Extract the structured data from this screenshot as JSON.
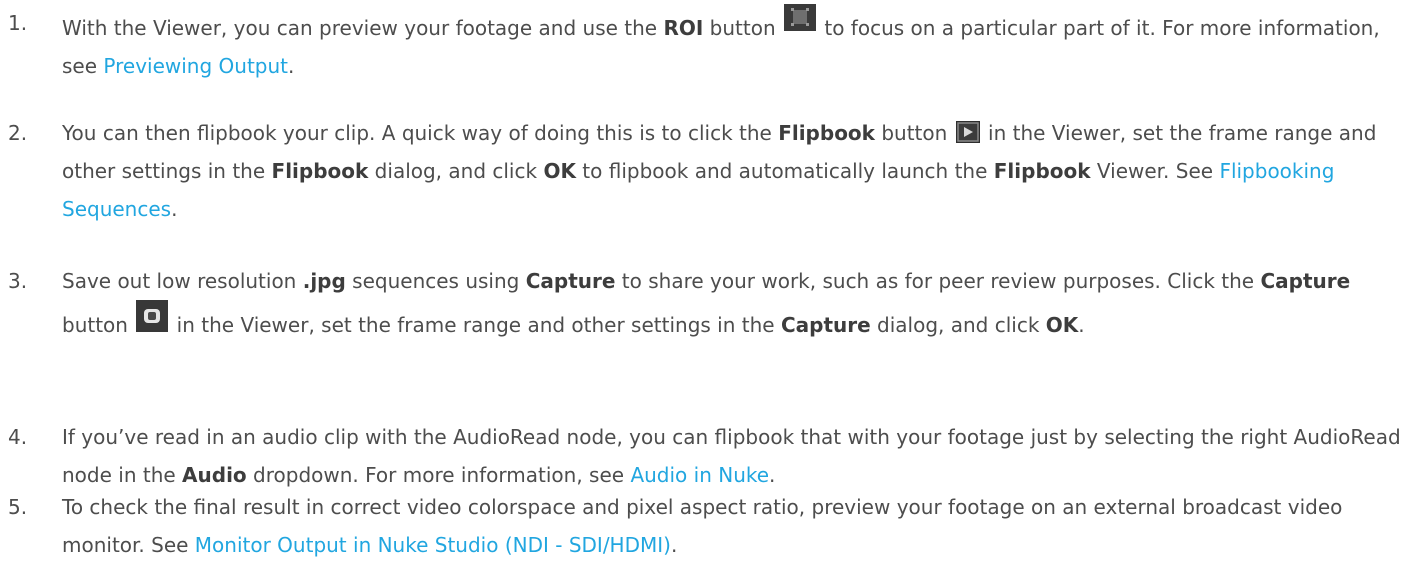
{
  "steps": [
    {
      "number": "1.",
      "t1": "With the Viewer, you can preview your footage and use the ",
      "b1": "ROI",
      "t2": " button ",
      "t3": " to focus on a particular part of it. For more information, see ",
      "link": "Previewing Output",
      "t4": "."
    },
    {
      "number": "2.",
      "t1": "You can then flipbook your clip. A quick way of doing this is to click the ",
      "b1": "Flipbook",
      "t2": " button ",
      "t3": " in the Viewer, set the frame range and other settings in the ",
      "b2": "Flipbook",
      "t4": " dialog, and click ",
      "b3": "OK",
      "t5": " to flipbook and automatically launch the ",
      "b4": "Flipbook",
      "t6": " Viewer. See ",
      "link": "Flipbooking Sequences",
      "t7": "."
    },
    {
      "number": "3.",
      "t1": "Save out low resolution ",
      "b1": ".jpg",
      "t2": " sequences using ",
      "b2": "Capture",
      "t3": " to share your work, such as for peer review purposes. Click the ",
      "b3": "Capture",
      "t4": " button ",
      "t5": " in the Viewer, set the frame range and other settings in the ",
      "b4": "Capture",
      "t6": " dialog, and click ",
      "b5": "OK",
      "t7": "."
    },
    {
      "number": "4.",
      "t1": "If you’ve read in an audio clip with the AudioRead node, you can flipbook that with your footage just by selecting the right AudioRead node in the ",
      "b1": "Audio",
      "t2": " dropdown. For more information, see ",
      "link": "Audio in Nuke",
      "t3": "."
    },
    {
      "number": "5.",
      "t1": "To check the final result in correct video colorspace and pixel aspect ratio, preview your footage on an external broadcast video monitor. See ",
      "link": "Monitor Output in Nuke Studio (NDI - SDI/HDMI)",
      "t2": "."
    }
  ],
  "colors": {
    "text": "#4d4d4d",
    "link": "#21a6e0",
    "icon_bg": "#3a3a3a"
  },
  "icons": {
    "roi": "roi-button-icon",
    "flipbook": "flipbook-button-icon",
    "capture": "capture-button-icon"
  }
}
